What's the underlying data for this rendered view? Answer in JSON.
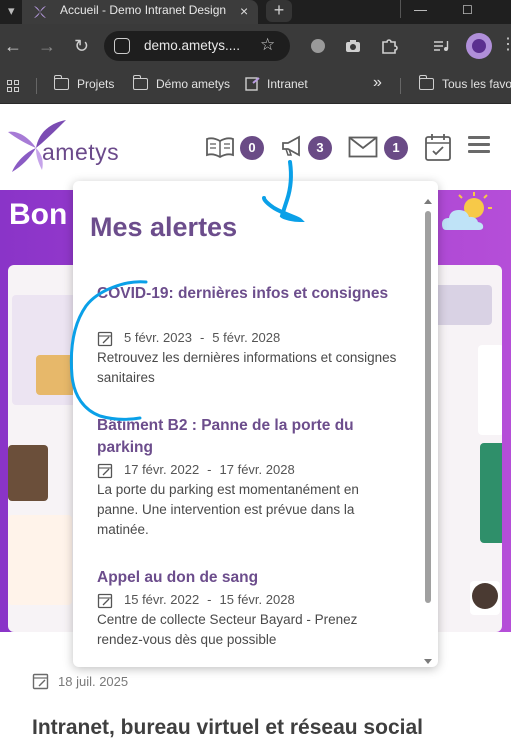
{
  "browser": {
    "tab_title": "Accueil - Demo Intranet Design",
    "new_tab_icon": "plus-icon",
    "url": "demo.ametys....",
    "icons": [
      "back-arrow-icon",
      "forward-arrow-icon",
      "reload-icon",
      "site-info-icon",
      "star-icon",
      "extension-puzzle-icon",
      "camera-icon",
      "media-control-icon",
      "profile-avatar-icon"
    ],
    "bookmarks": [
      "Projets",
      "Démo ametys",
      "Intranet",
      "Tous les favo"
    ],
    "overflow": "»"
  },
  "site": {
    "logo_text": "ametys",
    "counters": {
      "news": "0",
      "alerts": "3",
      "messages": "1"
    },
    "icons": [
      "book-icon",
      "megaphone-icon",
      "mail-icon",
      "calendar-icon",
      "menu-icon"
    ]
  },
  "hero": {
    "greeting": "Bon",
    "weather_icon": "sun-cloud-icon"
  },
  "alerts_popup": {
    "title": "Mes alertes",
    "items": [
      {
        "title": "COVID-19: dernières infos et consignes",
        "start": "5 févr. 2023",
        "end": "5 févr. 2028",
        "description": "Retrouvez les dernières informations et consignes sanitaires"
      },
      {
        "title": "Bâtiment B2 : Panne de la porte du parking",
        "start": "17 févr. 2022",
        "end": "17 févr. 2028",
        "description": "La porte du parking est momentanément en panne. Une intervention est prévue dans la matinée."
      },
      {
        "title": "Appel au don de sang",
        "start": "15 févr. 2022",
        "end": "15 févr. 2028",
        "description": "Centre de collecte Secteur Bayard - Prenez rendez-vous dès que possible"
      }
    ],
    "date_separator": "-"
  },
  "article": {
    "date": "18 juil. 2025",
    "title": "Intranet, bureau virtuel et réseau social"
  },
  "colors": {
    "brand_purple": "#6c4d8c",
    "hero_purple": "#9b3dcf",
    "annotation_blue": "#0aa0e8"
  }
}
